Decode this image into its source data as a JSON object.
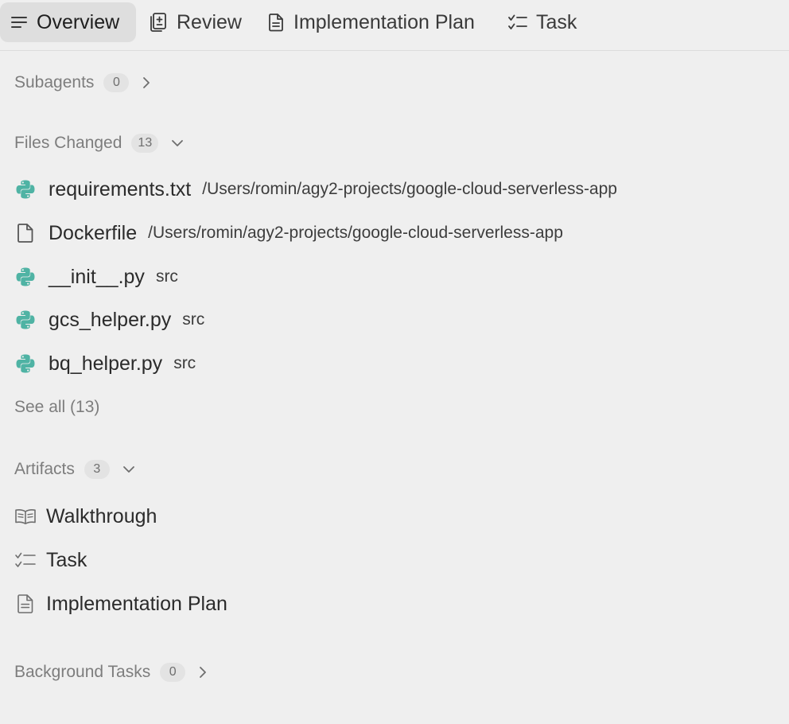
{
  "tabs": [
    {
      "label": "Overview",
      "icon": "menu-lines-icon",
      "active": true
    },
    {
      "label": "Review",
      "icon": "review-document-icon",
      "active": false
    },
    {
      "label": "Implementation Plan",
      "icon": "document-icon",
      "active": false
    },
    {
      "label": "Task",
      "icon": "checklist-icon",
      "active": false
    }
  ],
  "subagents": {
    "title": "Subagents",
    "count": "0"
  },
  "files_changed": {
    "title": "Files Changed",
    "count": "13",
    "items": [
      {
        "name": "requirements.txt",
        "path": "/Users/romin/agy2-projects/google-cloud-serverless-app",
        "icon": "python-icon"
      },
      {
        "name": "Dockerfile",
        "path": "/Users/romin/agy2-projects/google-cloud-serverless-app",
        "icon": "file-icon"
      },
      {
        "name": "__init__.py",
        "path": "src",
        "icon": "python-icon"
      },
      {
        "name": "gcs_helper.py",
        "path": "src",
        "icon": "python-icon"
      },
      {
        "name": "bq_helper.py",
        "path": "src",
        "icon": "python-icon"
      }
    ],
    "see_all": "See all (13)"
  },
  "artifacts": {
    "title": "Artifacts",
    "count": "3",
    "items": [
      {
        "label": "Walkthrough",
        "icon": "book-icon"
      },
      {
        "label": "Task",
        "icon": "checklist-icon"
      },
      {
        "label": "Implementation Plan",
        "icon": "document-icon"
      }
    ]
  },
  "background_tasks": {
    "title": "Background Tasks",
    "count": "0"
  },
  "colors": {
    "background": "#efefef",
    "active_tab": "#dedede",
    "python_icon": "#4fb3a4",
    "muted_text": "#7d7d7d"
  }
}
